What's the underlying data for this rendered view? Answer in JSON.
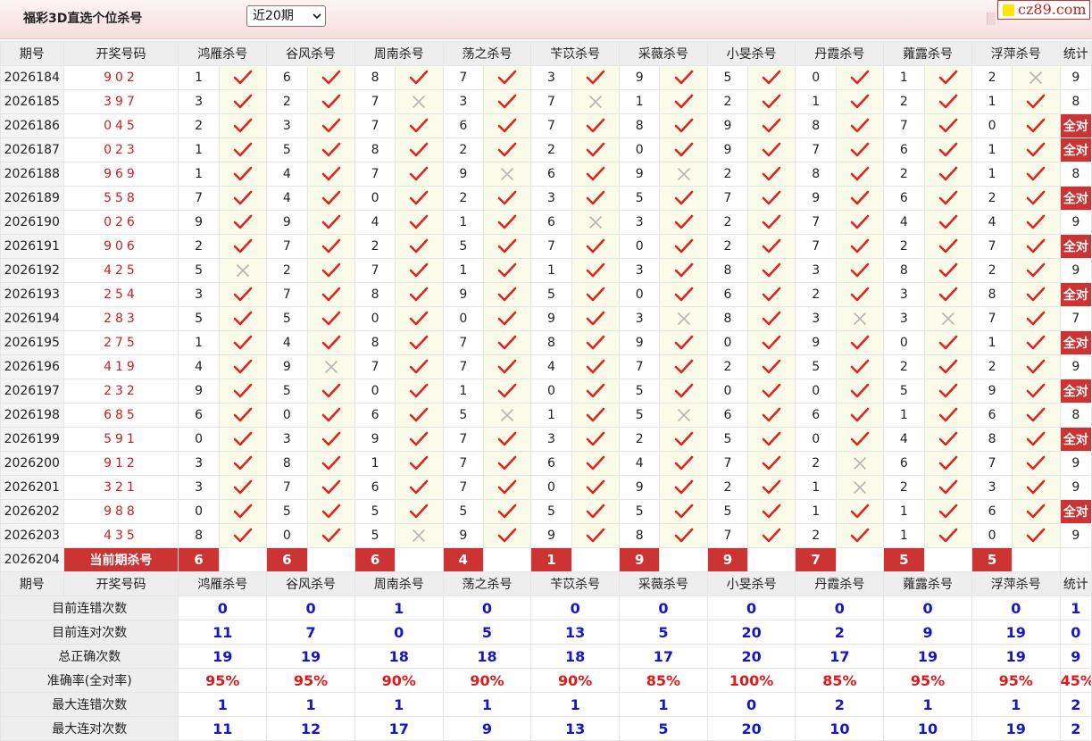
{
  "header": {
    "title": "福彩3D直选个位杀号",
    "period_selected": "近20期",
    "site_badge": "cz89.com"
  },
  "table": {
    "columns": [
      "期号",
      "开奖号码",
      "鸿雁杀号",
      "谷风杀号",
      "周南杀号",
      "荡之杀号",
      "苄苡杀号",
      "采薇杀号",
      "小旻杀号",
      "丹霞杀号",
      "蕹露杀号",
      "浮萍杀号",
      "统计"
    ],
    "all_correct_label": "全对",
    "rows": [
      {
        "issue": "2026184",
        "draw": "902",
        "kills": [
          1,
          6,
          8,
          7,
          3,
          9,
          5,
          0,
          1,
          2
        ],
        "results": [
          1,
          1,
          1,
          1,
          1,
          1,
          1,
          1,
          1,
          0
        ],
        "stat": "9"
      },
      {
        "issue": "2026185",
        "draw": "397",
        "kills": [
          3,
          2,
          7,
          3,
          7,
          1,
          2,
          1,
          2,
          1
        ],
        "results": [
          1,
          1,
          0,
          1,
          0,
          1,
          1,
          1,
          1,
          1
        ],
        "stat": "8"
      },
      {
        "issue": "2026186",
        "draw": "045",
        "kills": [
          2,
          3,
          7,
          6,
          7,
          8,
          9,
          8,
          7,
          0
        ],
        "results": [
          1,
          1,
          1,
          1,
          1,
          1,
          1,
          1,
          1,
          1
        ],
        "stat": "全对"
      },
      {
        "issue": "2026187",
        "draw": "023",
        "kills": [
          1,
          5,
          8,
          2,
          2,
          0,
          9,
          7,
          6,
          1
        ],
        "results": [
          1,
          1,
          1,
          1,
          1,
          1,
          1,
          1,
          1,
          1
        ],
        "stat": "全对"
      },
      {
        "issue": "2026188",
        "draw": "969",
        "kills": [
          1,
          4,
          7,
          9,
          6,
          9,
          2,
          8,
          2,
          1
        ],
        "results": [
          1,
          1,
          1,
          0,
          1,
          0,
          1,
          1,
          1,
          1
        ],
        "stat": "8"
      },
      {
        "issue": "2026189",
        "draw": "558",
        "kills": [
          7,
          4,
          0,
          2,
          3,
          5,
          7,
          9,
          6,
          2
        ],
        "results": [
          1,
          1,
          1,
          1,
          1,
          1,
          1,
          1,
          1,
          1
        ],
        "stat": "全对"
      },
      {
        "issue": "2026190",
        "draw": "026",
        "kills": [
          9,
          9,
          4,
          1,
          6,
          3,
          2,
          7,
          4,
          4
        ],
        "results": [
          1,
          1,
          1,
          1,
          0,
          1,
          1,
          1,
          1,
          1
        ],
        "stat": "9"
      },
      {
        "issue": "2026191",
        "draw": "906",
        "kills": [
          2,
          7,
          2,
          5,
          7,
          0,
          2,
          7,
          2,
          7
        ],
        "results": [
          1,
          1,
          1,
          1,
          1,
          1,
          1,
          1,
          1,
          1
        ],
        "stat": "全对"
      },
      {
        "issue": "2026192",
        "draw": "425",
        "kills": [
          5,
          2,
          7,
          1,
          1,
          3,
          8,
          3,
          8,
          2
        ],
        "results": [
          0,
          1,
          1,
          1,
          1,
          1,
          1,
          1,
          1,
          1
        ],
        "stat": "9"
      },
      {
        "issue": "2026193",
        "draw": "254",
        "kills": [
          3,
          7,
          8,
          9,
          5,
          0,
          6,
          2,
          3,
          8
        ],
        "results": [
          1,
          1,
          1,
          1,
          1,
          1,
          1,
          1,
          1,
          1
        ],
        "stat": "全对"
      },
      {
        "issue": "2026194",
        "draw": "283",
        "kills": [
          5,
          5,
          0,
          0,
          9,
          3,
          8,
          3,
          3,
          7
        ],
        "results": [
          1,
          1,
          1,
          1,
          1,
          0,
          1,
          0,
          0,
          1
        ],
        "stat": "7"
      },
      {
        "issue": "2026195",
        "draw": "275",
        "kills": [
          1,
          4,
          8,
          7,
          8,
          9,
          0,
          9,
          0,
          1
        ],
        "results": [
          1,
          1,
          1,
          1,
          1,
          1,
          1,
          1,
          1,
          1
        ],
        "stat": "全对"
      },
      {
        "issue": "2026196",
        "draw": "419",
        "kills": [
          4,
          9,
          7,
          7,
          4,
          7,
          2,
          5,
          2,
          2
        ],
        "results": [
          1,
          0,
          1,
          1,
          1,
          1,
          1,
          1,
          1,
          1
        ],
        "stat": "9"
      },
      {
        "issue": "2026197",
        "draw": "232",
        "kills": [
          9,
          5,
          0,
          1,
          0,
          5,
          0,
          0,
          5,
          9
        ],
        "results": [
          1,
          1,
          1,
          1,
          1,
          1,
          1,
          1,
          1,
          1
        ],
        "stat": "全对"
      },
      {
        "issue": "2026198",
        "draw": "685",
        "kills": [
          6,
          0,
          6,
          5,
          1,
          5,
          6,
          6,
          1,
          6
        ],
        "results": [
          1,
          1,
          1,
          0,
          1,
          0,
          1,
          1,
          1,
          1
        ],
        "stat": "8"
      },
      {
        "issue": "2026199",
        "draw": "591",
        "kills": [
          0,
          3,
          9,
          7,
          3,
          2,
          5,
          0,
          4,
          8
        ],
        "results": [
          1,
          1,
          1,
          1,
          1,
          1,
          1,
          1,
          1,
          1
        ],
        "stat": "全对"
      },
      {
        "issue": "2026200",
        "draw": "912",
        "kills": [
          3,
          8,
          1,
          7,
          6,
          4,
          7,
          2,
          6,
          7
        ],
        "results": [
          1,
          1,
          1,
          1,
          1,
          1,
          1,
          0,
          1,
          1
        ],
        "stat": "9"
      },
      {
        "issue": "2026201",
        "draw": "321",
        "kills": [
          3,
          7,
          6,
          7,
          0,
          9,
          2,
          1,
          2,
          3
        ],
        "results": [
          1,
          1,
          1,
          1,
          1,
          1,
          1,
          0,
          1,
          1
        ],
        "stat": "9"
      },
      {
        "issue": "2026202",
        "draw": "988",
        "kills": [
          0,
          5,
          5,
          5,
          5,
          5,
          5,
          1,
          1,
          6
        ],
        "results": [
          1,
          1,
          1,
          1,
          1,
          1,
          1,
          1,
          1,
          1
        ],
        "stat": "全对"
      },
      {
        "issue": "2026203",
        "draw": "435",
        "kills": [
          8,
          0,
          5,
          9,
          9,
          8,
          7,
          2,
          1,
          0
        ],
        "results": [
          1,
          1,
          0,
          1,
          1,
          1,
          1,
          1,
          1,
          1
        ],
        "stat": "9"
      }
    ],
    "current": {
      "issue": "2026204",
      "label": "当前期杀号",
      "kills": [
        "6",
        "6",
        "6",
        "4",
        "1",
        "9",
        "9",
        "7",
        "5",
        "5"
      ]
    }
  },
  "stats": {
    "header": [
      "期号",
      "开奖号码",
      "鸿雁杀号",
      "谷风杀号",
      "周南杀号",
      "荡之杀号",
      "苄苡杀号",
      "采薇杀号",
      "小旻杀号",
      "丹霞杀号",
      "蕹露杀号",
      "浮萍杀号",
      "统计"
    ],
    "rows": [
      {
        "label": "目前连错次数",
        "color": "blue",
        "values": [
          "0",
          "0",
          "1",
          "0",
          "0",
          "0",
          "0",
          "0",
          "0",
          "0",
          "1"
        ]
      },
      {
        "label": "目前连对次数",
        "color": "blue",
        "values": [
          "11",
          "7",
          "0",
          "5",
          "13",
          "5",
          "20",
          "2",
          "9",
          "19",
          "0"
        ]
      },
      {
        "label": "总正确次数",
        "color": "blue",
        "values": [
          "19",
          "19",
          "18",
          "18",
          "18",
          "17",
          "20",
          "17",
          "19",
          "19",
          "9"
        ]
      },
      {
        "label": "准确率(全对率)",
        "color": "red",
        "values": [
          "95%",
          "95%",
          "90%",
          "90%",
          "90%",
          "85%",
          "100%",
          "85%",
          "95%",
          "95%",
          "45%"
        ]
      },
      {
        "label": "最大连错次数",
        "color": "blue",
        "values": [
          "1",
          "1",
          "1",
          "1",
          "1",
          "1",
          "0",
          "2",
          "1",
          "1",
          "2"
        ]
      },
      {
        "label": "最大连对次数",
        "color": "blue",
        "values": [
          "11",
          "12",
          "17",
          "9",
          "13",
          "5",
          "20",
          "10",
          "10",
          "19",
          "2"
        ]
      }
    ]
  },
  "colors": {
    "accent_red": "#cc3333",
    "draw_red": "#d21c1c",
    "check_red": "#e02424",
    "stat_blue": "#1616c8",
    "cross_gray": "#b5b5b5",
    "result_bg": "#fbfbe9"
  },
  "icons": {
    "correct": "check-mark-icon",
    "wrong": "cross-mark-icon",
    "dropdown": "chevron-down-icon"
  }
}
